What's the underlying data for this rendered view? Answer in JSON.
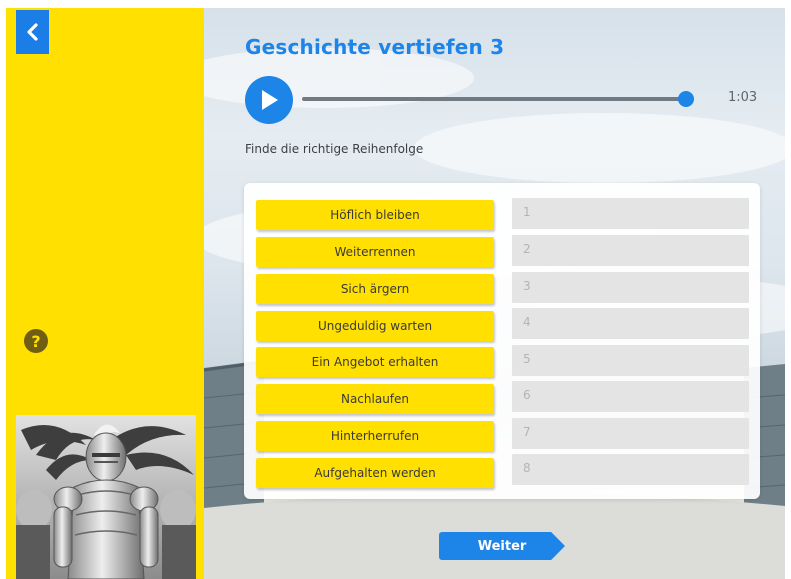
{
  "sidebar": {
    "back_icon": "chevron-left-icon",
    "help_label": "?",
    "accent_color": "#ffe000"
  },
  "main": {
    "title": "Geschichte vertiefen 3",
    "audio": {
      "duration": "1:03",
      "progress": 0.98
    },
    "instruction": "Finde die richtige Reihenfolge",
    "items": [
      "Höflich bleiben",
      "Weiterrennen",
      "Sich ärgern",
      "Ungeduldig warten",
      "Ein Angebot erhalten",
      "Nachlaufen",
      "Hinterherrufen",
      "Aufgehalten werden"
    ],
    "slots": [
      "1",
      "2",
      "3",
      "4",
      "5",
      "6",
      "7",
      "8"
    ],
    "next_label": "Weiter",
    "brand_color": "#1d84e8"
  }
}
